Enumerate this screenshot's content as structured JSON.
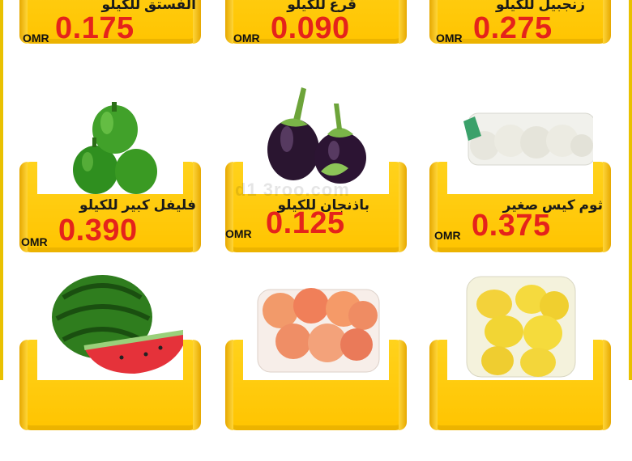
{
  "currency": "OMR",
  "watermark": "d1 3roo.com",
  "rows": [
    [
      {
        "name": "الفستق للكيلو",
        "price": "0.175"
      },
      {
        "name": "قرع للكيلو",
        "price": "0.090"
      },
      {
        "name": "زنجبيل للكيلو",
        "price": "0.275"
      }
    ],
    [
      {
        "name": "فليفل كبير للكيلو",
        "price": "0.390",
        "image": "green-pepper"
      },
      {
        "name": "باذنجان للكيلو",
        "price": "0.125",
        "image": "eggplant"
      },
      {
        "name": "ثوم كيس صغير",
        "price": "0.375",
        "image": "garlic-bag"
      }
    ],
    [
      {
        "image": "watermelon"
      },
      {
        "image": "peaches-box"
      },
      {
        "image": "lemons-box"
      }
    ]
  ]
}
